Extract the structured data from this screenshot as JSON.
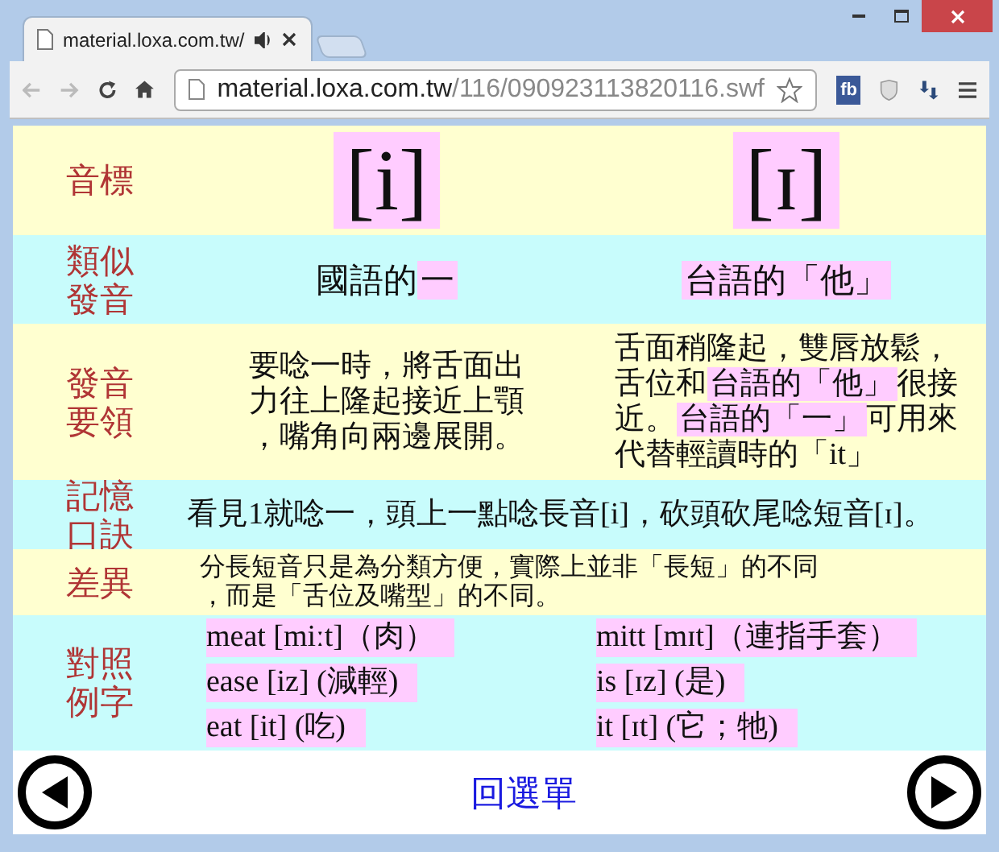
{
  "browser": {
    "tab_title": "material.loxa.com.tw/",
    "address_host": "material.loxa.com.tw",
    "address_path": "/116/090923113820116.swf",
    "extension_label": "fb"
  },
  "rows": [
    {
      "kind": "symbols",
      "label": [
        "音標"
      ],
      "cells": [
        "[i]",
        "[ɪ]"
      ]
    },
    {
      "kind": "similar",
      "label": [
        "類似",
        "發音"
      ],
      "cells": [
        [
          {
            "text": "國語的",
            "highlight": false
          },
          {
            "text": "一",
            "highlight": true
          }
        ],
        [
          {
            "text": "台語的「他」",
            "highlight": true
          }
        ]
      ]
    },
    {
      "kind": "paragraphs",
      "label": [
        "發音",
        "要領"
      ],
      "cells": [
        [
          [
            {
              "text": "要唸一時，將舌面出",
              "highlight": false
            }
          ],
          [
            {
              "text": "力往上隆起接近上顎",
              "highlight": false
            }
          ],
          [
            {
              "text": "，嘴角向兩邊展開。",
              "highlight": false
            }
          ]
        ],
        [
          [
            {
              "text": "舌面稍隆起，雙唇放鬆，",
              "highlight": false
            }
          ],
          [
            {
              "text": "舌位和",
              "highlight": false
            },
            {
              "text": "台語的「他」",
              "highlight": true
            },
            {
              "text": "很接",
              "highlight": false
            }
          ],
          [
            {
              "text": "近。",
              "highlight": false
            },
            {
              "text": "台語的「一」",
              "highlight": true
            },
            {
              "text": "可用來",
              "highlight": false
            }
          ],
          [
            {
              "text": "代替輕讀時的「it」",
              "highlight": false
            }
          ]
        ]
      ]
    },
    {
      "kind": "wide",
      "label": [
        "記憶",
        "口訣"
      ],
      "cells": [
        "看見1就唸一，頭上一點唸長音[i]，砍頭砍尾唸短音[ɪ]。"
      ]
    },
    {
      "kind": "note",
      "label": [
        "差異"
      ],
      "cells": [
        "分長短音只是為分類方便，實際上並非「長短」的不同",
        "，而是「舌位及嘴型」的不同。"
      ]
    },
    {
      "kind": "examples",
      "label": [
        "對照",
        "例字"
      ],
      "cells": [
        [
          "meat [miːt]（肉）",
          "ease [iz] (減輕)",
          "eat [it] (吃)"
        ],
        [
          "mitt [mɪt]（連指手套）",
          "is [ɪz] (是)",
          "it [ɪt] (它；牠)"
        ]
      ]
    }
  ],
  "menu_link": "回選單"
}
